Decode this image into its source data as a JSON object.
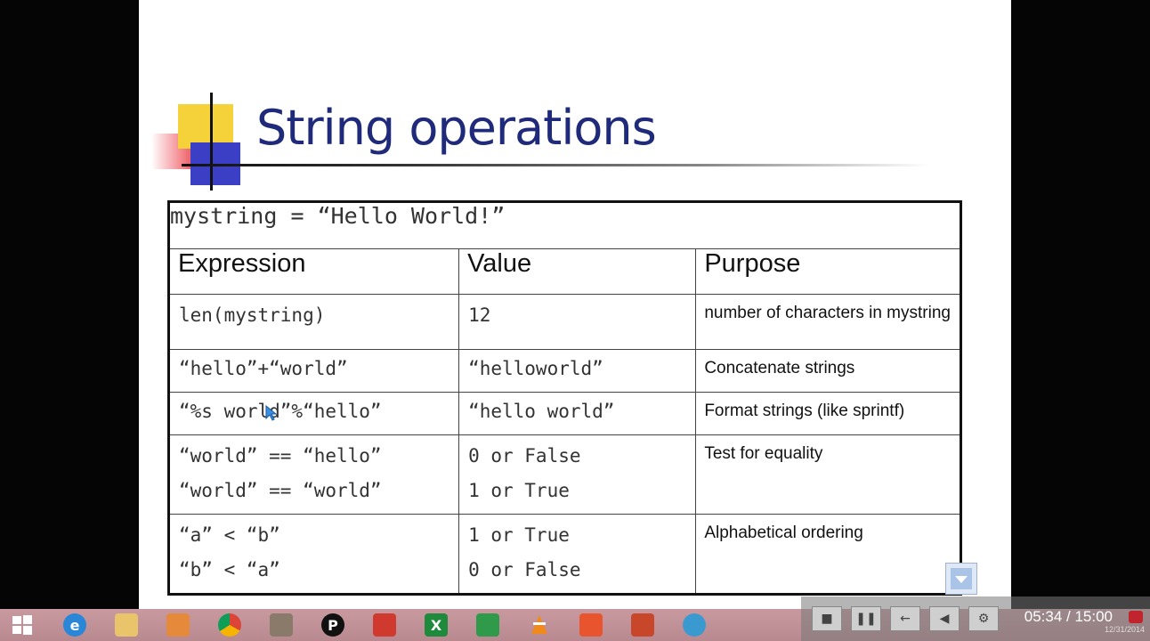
{
  "slide": {
    "title": "String operations",
    "declaration": "mystring = “Hello World!”",
    "headers": [
      "Expression",
      "Value",
      "Purpose"
    ],
    "rows": [
      {
        "expressions": [
          "len(mystring)"
        ],
        "values": [
          "12"
        ],
        "purpose": "number of characters in mystring"
      },
      {
        "expressions": [
          "“hello”+“world”"
        ],
        "values": [
          "“helloworld”"
        ],
        "purpose": "Concatenate strings"
      },
      {
        "expressions": [
          "“%s world”%“hello”"
        ],
        "values": [
          "“hello world”"
        ],
        "purpose": "Format strings (like sprintf)"
      },
      {
        "expressions": [
          "“world” == “hello”",
          "“world” == “world”"
        ],
        "values": [
          "0 or False",
          "1 or True"
        ],
        "purpose": "Test for equality"
      },
      {
        "expressions": [
          "“a” < “b”",
          "“b” < “a”"
        ],
        "values": [
          "1 or True",
          "0 or False"
        ],
        "purpose": "Alphabetical ordering"
      }
    ]
  },
  "player": {
    "time": "05:34 / 15:00",
    "date": "12/31/2014",
    "buttons": [
      "stop-icon",
      "pause-icon",
      "back-icon",
      "volume-icon",
      "settings-icon"
    ]
  },
  "taskbar": {
    "icons": [
      "windows-start-icon",
      "internet-explorer-icon",
      "file-explorer-icon",
      "paint-icon",
      "chrome-icon",
      "media-player-icon",
      "pdf-reader-icon",
      "powerpoint-red-icon",
      "excel-icon",
      "publisher-icon",
      "vlc-icon",
      "office-red-icon",
      "powerpoint-icon",
      "screen-recorder-icon"
    ]
  },
  "colors": {
    "title": "#1f2a7a",
    "taskbar": "#c89aa0"
  }
}
